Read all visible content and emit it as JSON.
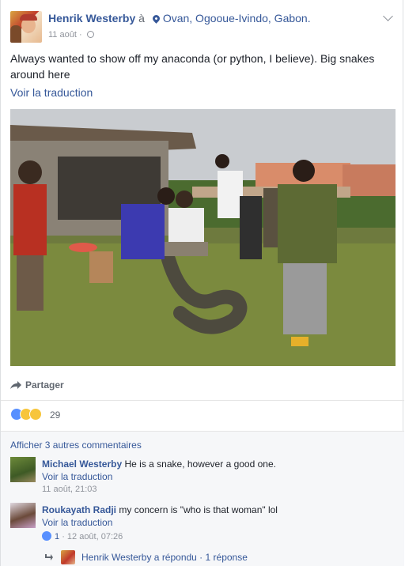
{
  "post": {
    "author": "Henrik Westerby",
    "at": "à",
    "location": "Ovan, Ogooue-Ivindo, Gabon.",
    "date": "11 août",
    "dot": "·",
    "text": "Always wanted to show off my anaconda (or python, I believe). Big snakes around here",
    "see_translation": "Voir la traduction"
  },
  "actions": {
    "share": "Partager"
  },
  "reactions": {
    "count": "29",
    "icons": [
      "like-icon",
      "wow-icon",
      "haha-icon"
    ]
  },
  "comments": {
    "more_label": "Afficher 3 autres commentaires",
    "items": [
      {
        "author": "Michael Westerby",
        "text": "He is a snake, however a good one.",
        "translate": "Voir la traduction",
        "time": "11 août, 21:03"
      },
      {
        "author": "Roukayath Radji",
        "text": "my concern is \"who is that woman\" lol",
        "translate": "Voir la traduction",
        "likes": "1",
        "time": "· 12 août, 07:26"
      }
    ],
    "reply_summary": "Henrik Westerby a répondu · 1 réponse"
  },
  "colors": {
    "link": "#365899",
    "muted": "#90949c",
    "comment_bg": "#f6f7f9"
  }
}
